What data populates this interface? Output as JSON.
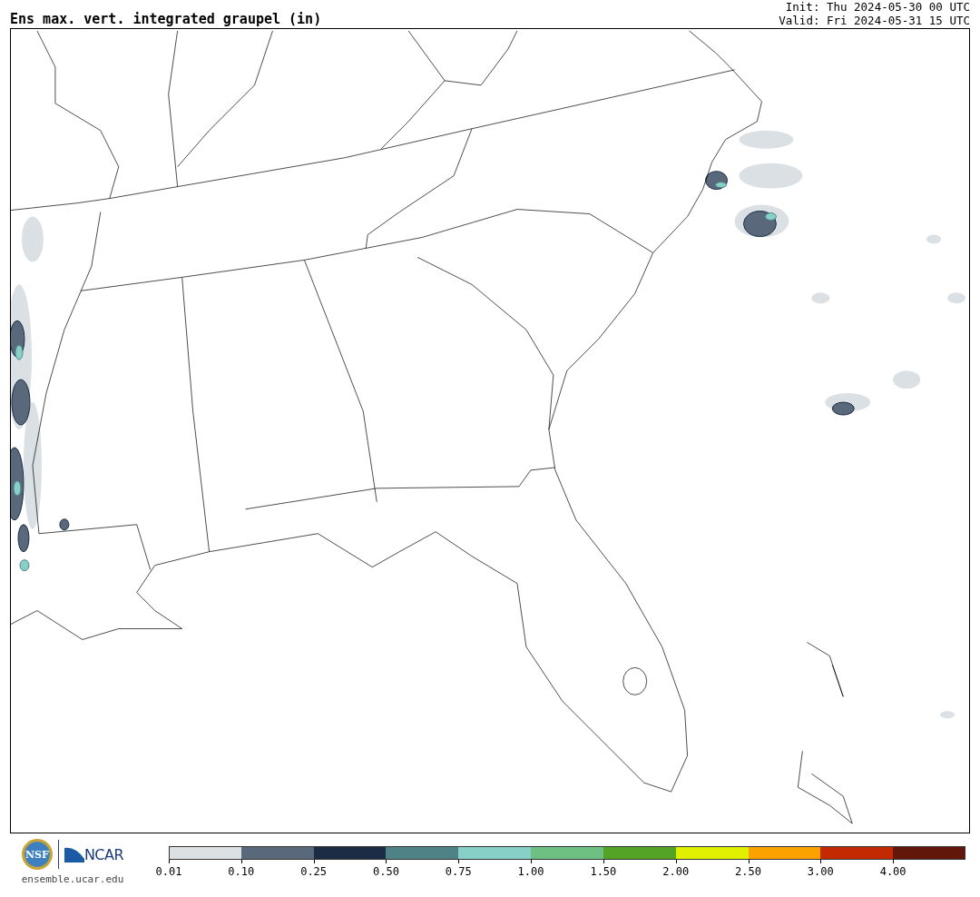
{
  "title": "Ens max. vert. integrated graupel (in)",
  "init": "Init: Thu 2024-05-30 00 UTC",
  "valid": "Valid: Fri 2024-05-31 15 UTC",
  "logos": {
    "nsf": "NSF",
    "ncar": "NCAR",
    "url": "ensemble.ucar.edu"
  },
  "legend": {
    "bins": [
      {
        "color": "#dbe0e4",
        "tick": "0.01"
      },
      {
        "color": "#59687b",
        "tick": "0.10"
      },
      {
        "color": "#1b2c44",
        "tick": "0.25"
      },
      {
        "color": "#4f8286",
        "tick": "0.50"
      },
      {
        "color": "#86d0c8",
        "tick": "0.75"
      },
      {
        "color": "#6dbf83",
        "tick": "1.00"
      },
      {
        "color": "#55a325",
        "tick": "1.50"
      },
      {
        "color": "#e1f000",
        "tick": "2.00"
      },
      {
        "color": "#fca200",
        "tick": "2.50"
      },
      {
        "color": "#c42a02",
        "tick": "3.00"
      },
      {
        "color": "#63170b",
        "tick": "4.00"
      }
    ]
  }
}
